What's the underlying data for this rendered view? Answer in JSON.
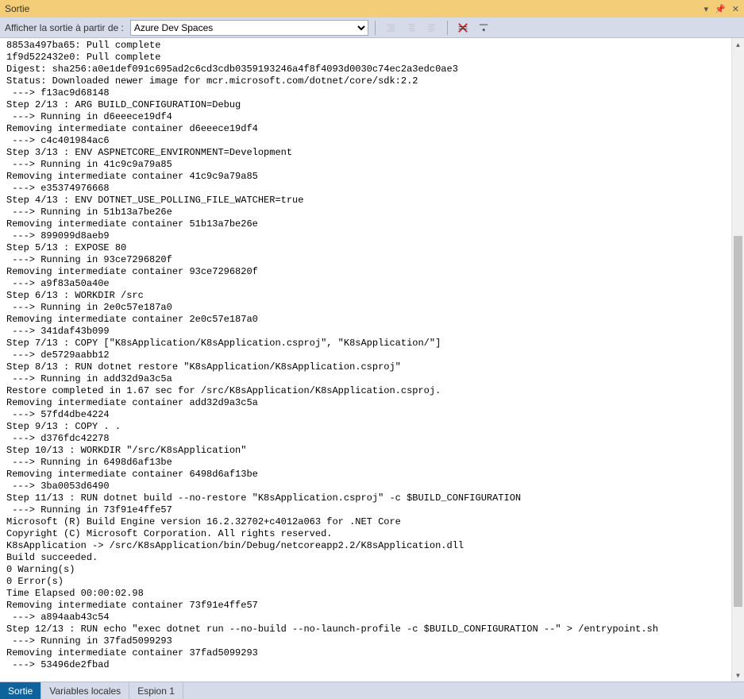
{
  "window": {
    "title": "Sortie"
  },
  "toolbar": {
    "label": "Afficher la sortie à partir de :",
    "source": "Azure Dev Spaces"
  },
  "output_lines": [
    "8853a497ba65: Pull complete",
    "1f9d522432e0: Pull complete",
    "Digest: sha256:a0e1def091c695ad2c6cd3cdb0359193246a4f8f4093d0030c74ec2a3edc0ae3",
    "Status: Downloaded newer image for mcr.microsoft.com/dotnet/core/sdk:2.2",
    " ---> f13ac9d68148",
    "Step 2/13 : ARG BUILD_CONFIGURATION=Debug",
    " ---> Running in d6eeece19df4",
    "Removing intermediate container d6eeece19df4",
    " ---> c4c401984ac6",
    "Step 3/13 : ENV ASPNETCORE_ENVIRONMENT=Development",
    " ---> Running in 41c9c9a79a85",
    "Removing intermediate container 41c9c9a79a85",
    " ---> e35374976668",
    "Step 4/13 : ENV DOTNET_USE_POLLING_FILE_WATCHER=true",
    " ---> Running in 51b13a7be26e",
    "Removing intermediate container 51b13a7be26e",
    " ---> 899099d8aeb9",
    "Step 5/13 : EXPOSE 80",
    " ---> Running in 93ce7296820f",
    "Removing intermediate container 93ce7296820f",
    " ---> a9f83a50a40e",
    "Step 6/13 : WORKDIR /src",
    " ---> Running in 2e0c57e187a0",
    "Removing intermediate container 2e0c57e187a0",
    " ---> 341daf43b099",
    "Step 7/13 : COPY [\"K8sApplication/K8sApplication.csproj\", \"K8sApplication/\"]",
    " ---> de5729aabb12",
    "Step 8/13 : RUN dotnet restore \"K8sApplication/K8sApplication.csproj\"",
    " ---> Running in add32d9a3c5a",
    "Restore completed in 1.67 sec for /src/K8sApplication/K8sApplication.csproj.",
    "Removing intermediate container add32d9a3c5a",
    " ---> 57fd4dbe4224",
    "Step 9/13 : COPY . .",
    " ---> d376fdc42278",
    "Step 10/13 : WORKDIR \"/src/K8sApplication\"",
    " ---> Running in 6498d6af13be",
    "Removing intermediate container 6498d6af13be",
    " ---> 3ba0053d6490",
    "Step 11/13 : RUN dotnet build --no-restore \"K8sApplication.csproj\" -c $BUILD_CONFIGURATION",
    " ---> Running in 73f91e4ffe57",
    "Microsoft (R) Build Engine version 16.2.32702+c4012a063 for .NET Core",
    "Copyright (C) Microsoft Corporation. All rights reserved.",
    "K8sApplication -> /src/K8sApplication/bin/Debug/netcoreapp2.2/K8sApplication.dll",
    "Build succeeded.",
    "0 Warning(s)",
    "0 Error(s)",
    "Time Elapsed 00:00:02.98",
    "Removing intermediate container 73f91e4ffe57",
    " ---> a894aab43c54",
    "Step 12/13 : RUN echo \"exec dotnet run --no-build --no-launch-profile -c $BUILD_CONFIGURATION --\" > /entrypoint.sh",
    " ---> Running in 37fad5099293",
    "Removing intermediate container 37fad5099293",
    " ---> 53496de2fbad"
  ],
  "tabs": [
    {
      "label": "Sortie",
      "active": true
    },
    {
      "label": "Variables locales",
      "active": false
    },
    {
      "label": "Espion 1",
      "active": false
    }
  ]
}
